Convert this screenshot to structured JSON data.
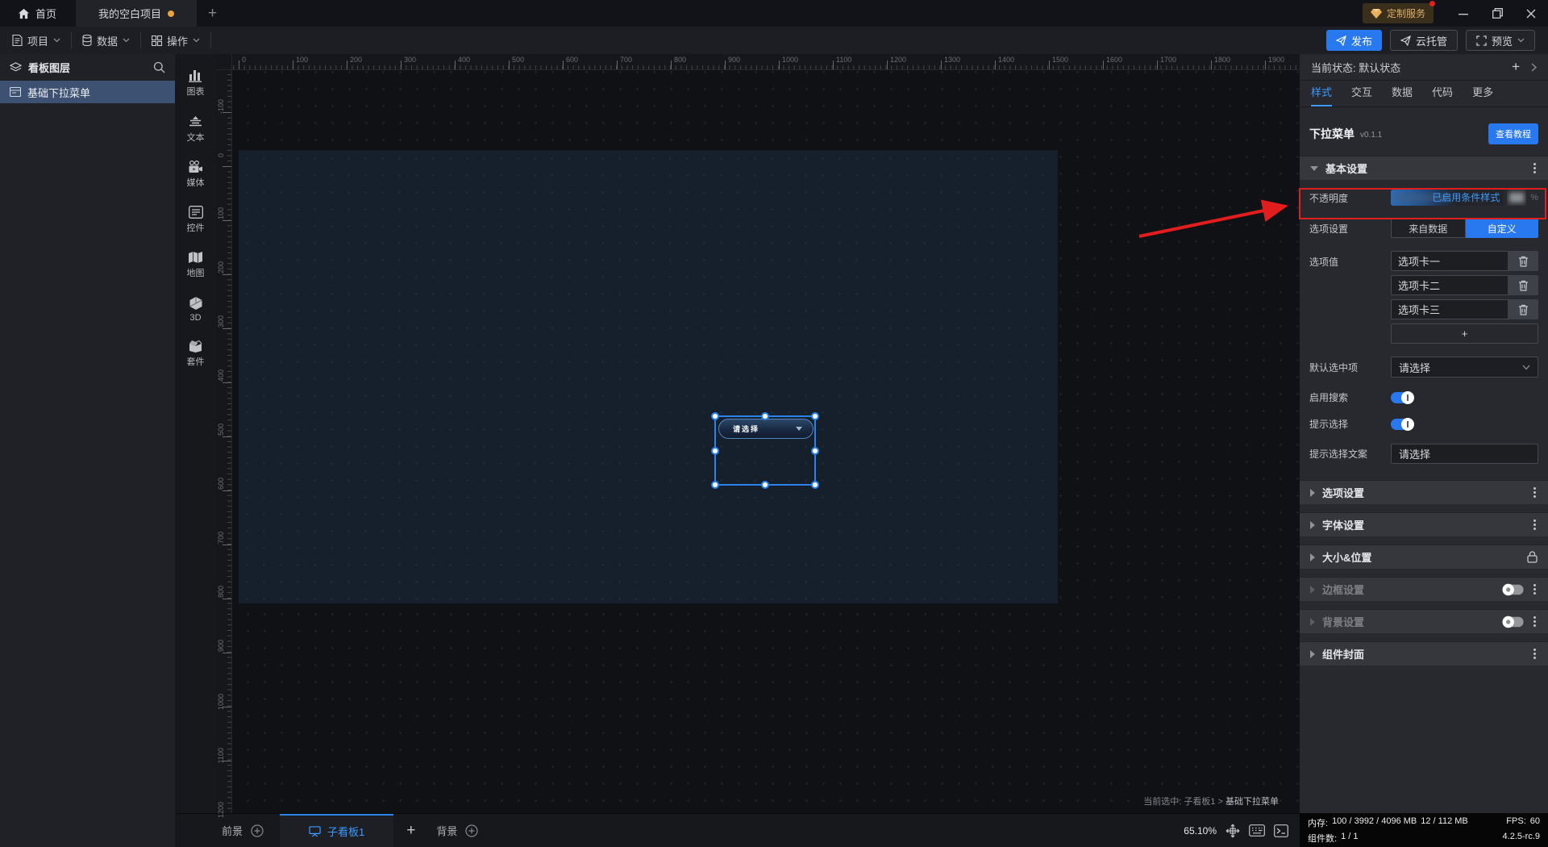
{
  "titlebar": {
    "home_label": "首页",
    "project_tab_label": "我的空白项目",
    "new_tab_label": "+",
    "badge_label": "定制服务"
  },
  "menubar": {
    "items": [
      {
        "label": "项目"
      },
      {
        "label": "数据"
      },
      {
        "label": "操作"
      }
    ],
    "publish_label": "发布",
    "cloud_label": "云托管",
    "preview_label": "预览"
  },
  "layers_panel": {
    "title": "看板图层",
    "items": [
      {
        "label": "基础下拉菜单",
        "selected": true
      }
    ]
  },
  "icon_strip": {
    "items": [
      {
        "icon": "chart-icon",
        "label": "图表"
      },
      {
        "icon": "text-icon",
        "label": "文本"
      },
      {
        "icon": "media-icon",
        "label": "媒体"
      },
      {
        "icon": "widget-icon",
        "label": "控件"
      },
      {
        "icon": "map-icon",
        "label": "地图"
      },
      {
        "icon": "3d-icon",
        "label": "3D"
      },
      {
        "icon": "kit-icon",
        "label": "套件"
      }
    ]
  },
  "canvas": {
    "h_ruler": {
      "start": 0,
      "step": 100,
      "count": 20
    },
    "v_ruler": {
      "start": -100,
      "step": 100,
      "count": 14
    },
    "component": {
      "placeholder": "请选择"
    },
    "breadcrumb": {
      "prefix": "当前选中: 子看板1 >",
      "current": "基础下拉菜单"
    }
  },
  "bottom_bar": {
    "foreground_label": "前景",
    "subboard_label": "子看板1",
    "add_label": "+",
    "background_label": "背景",
    "zoom_value": "65.10%"
  },
  "status_bar": {
    "memory_label": "内存:",
    "memory_value": "100 / 3992 / 4096 MB",
    "memory_value2": "12 / 112 MB",
    "fps_label": "FPS:",
    "fps_value": "60",
    "components_label": "组件数:",
    "components_value": "1 / 1",
    "version": "4.2.5-rc.9"
  },
  "right_panel": {
    "state_label": "当前状态:",
    "state_value": "默认状态",
    "add_state_label": "+",
    "tabs": [
      {
        "label": "样式",
        "active": true
      },
      {
        "label": "交互",
        "active": false
      },
      {
        "label": "数据",
        "active": false
      },
      {
        "label": "代码",
        "active": false
      },
      {
        "label": "更多",
        "active": false
      }
    ],
    "component_name": "下拉菜单",
    "component_version": "v0.1.1",
    "tutorial_button": "查看教程",
    "basic_section_title": "基本设置",
    "opacity": {
      "label": "不透明度",
      "overlay_text": "已启用条件样式",
      "unit": "%"
    },
    "option_source": {
      "label": "选项设置",
      "from_data_label": "来自数据",
      "custom_label": "自定义",
      "selected": "自定义"
    },
    "option_values": {
      "label": "选项值",
      "values": [
        "选项卡一",
        "选项卡二",
        "选项卡三"
      ],
      "add_label": "+"
    },
    "default_selected": {
      "label": "默认选中项",
      "value": "请选择"
    },
    "enable_search": {
      "label": "启用搜索",
      "on": true
    },
    "prompt_select": {
      "label": "提示选择",
      "on": true
    },
    "prompt_text": {
      "label": "提示选择文案",
      "value": "请选择"
    },
    "sections": [
      {
        "label": "选项设置"
      },
      {
        "label": "字体设置"
      },
      {
        "label": "大小&位置"
      },
      {
        "label": "边框设置",
        "disabled": true
      },
      {
        "label": "背景设置",
        "disabled": true
      },
      {
        "label": "组件封面"
      }
    ]
  }
}
